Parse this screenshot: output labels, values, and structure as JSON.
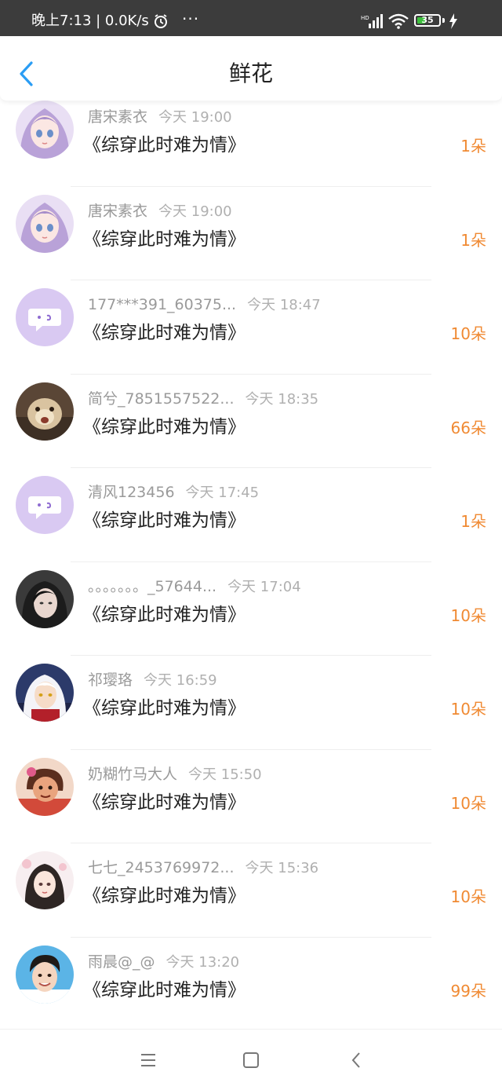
{
  "status_bar": {
    "time_text": "晚上7:13 | 0.0K/s",
    "battery": "35",
    "network": "HD"
  },
  "header": {
    "title": "鲜花"
  },
  "colors": {
    "accent_blue": "#2a9df4",
    "count_orange": "#f08a33"
  },
  "items": [
    {
      "name": "唐宋素衣",
      "time": "今天 19:00",
      "book": "《综穿此时难为情》",
      "count": "1朵",
      "avatar": "anime-girl"
    },
    {
      "name": "唐宋素衣",
      "time": "今天 19:00",
      "book": "《综穿此时难为情》",
      "count": "1朵",
      "avatar": "anime-girl"
    },
    {
      "name": "177***391_60375...",
      "time": "今天 18:47",
      "book": "《综穿此时难为情》",
      "count": "10朵",
      "avatar": "default-chat"
    },
    {
      "name": "简兮_7851557522...",
      "time": "今天 18:35",
      "book": "《综穿此时难为情》",
      "count": "66朵",
      "avatar": "hamster-photo"
    },
    {
      "name": "清风123456",
      "time": "今天 17:45",
      "book": "《综穿此时难为情》",
      "count": "1朵",
      "avatar": "default-chat"
    },
    {
      "name": "。。。。。。。_57644...",
      "time": "今天 17:04",
      "book": "《综穿此时难为情》",
      "count": "10朵",
      "avatar": "dark-portrait"
    },
    {
      "name": "祁璎珞",
      "time": "今天 16:59",
      "book": "《综穿此时难为情》",
      "count": "10朵",
      "avatar": "white-hair-anime"
    },
    {
      "name": "奶糊竹马大人",
      "time": "今天 15:50",
      "book": "《综穿此时难为情》",
      "count": "10朵",
      "avatar": "cartoon-character"
    },
    {
      "name": "七七_2453769972...",
      "time": "今天 15:36",
      "book": "《综穿此时难为情》",
      "count": "10朵",
      "avatar": "anime-lady"
    },
    {
      "name": "雨晨@_@",
      "time": "今天 13:20",
      "book": "《综穿此时难为情》",
      "count": "99朵",
      "avatar": "young-man-photo"
    }
  ],
  "nav_icons": [
    "menu-icon",
    "home-square-icon",
    "back-chevron-icon"
  ]
}
